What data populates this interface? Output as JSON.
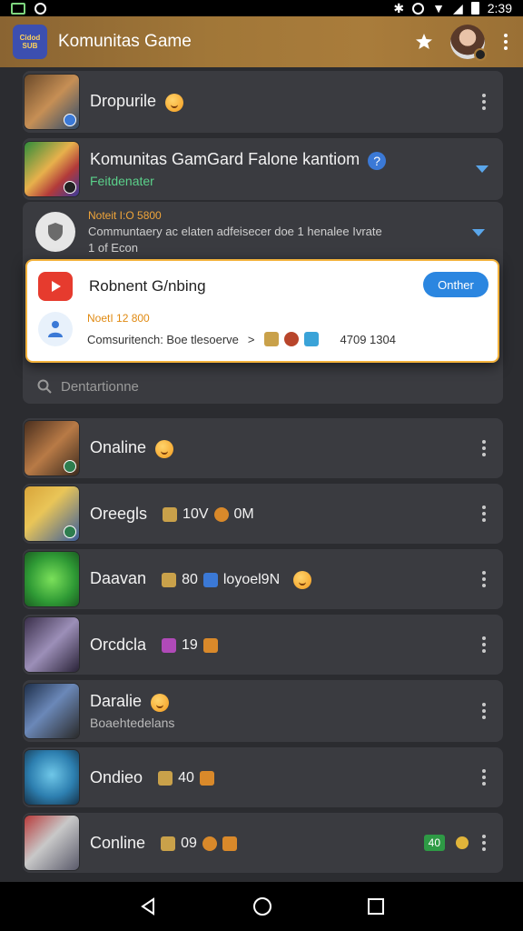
{
  "status_bar": {
    "time": "2:39"
  },
  "app_bar": {
    "logo_line1": "Cidod",
    "logo_line2": "SUB",
    "title": "Komunitas Game"
  },
  "items_top": [
    {
      "title": "Dropurile",
      "subtitle": ""
    },
    {
      "title": "Komunitas GamGard Falone kantiom",
      "subtitle": "Feitdenater"
    }
  ],
  "expanded": {
    "meta": "Noteit I:O 5800",
    "body_line1": "Communtaery ac elaten adfeisecer doe 1 henalee Ivrate",
    "body_line2": "1 of Econ"
  },
  "popup": {
    "title": "Robnent G/nbing",
    "follow_label": "Onther",
    "meta": "NoetI 12 800",
    "line": "Comsuritench: Boe tlesoerve",
    "arrow": ">",
    "count": "4709 1304"
  },
  "search": {
    "placeholder": "Dentartionne"
  },
  "list_items": [
    {
      "title": "Onaline",
      "stats": "",
      "subtitle": ""
    },
    {
      "title": "Oreegls",
      "stats": "10V",
      "stats2": "0M",
      "subtitle": ""
    },
    {
      "title": "Daavan",
      "stats": "80",
      "stats2": "loyoel9N",
      "subtitle": ""
    },
    {
      "title": "Orcdcla",
      "stats": "19",
      "stats2": "",
      "subtitle": ""
    },
    {
      "title": "Daralie",
      "stats": "",
      "subtitle": "Boaehtedelans"
    },
    {
      "title": "Ondieo",
      "stats": "40",
      "stats2": "",
      "subtitle": ""
    },
    {
      "title": "Conline",
      "stats": "09",
      "stats2": "",
      "badge": "40",
      "subtitle": ""
    }
  ],
  "colors": {
    "app_bar": "#a97c3b",
    "accent_blue": "#2b86e0",
    "accent_orange": "#f0a53a",
    "background": "#2b2c30",
    "card": "#3a3b40"
  }
}
